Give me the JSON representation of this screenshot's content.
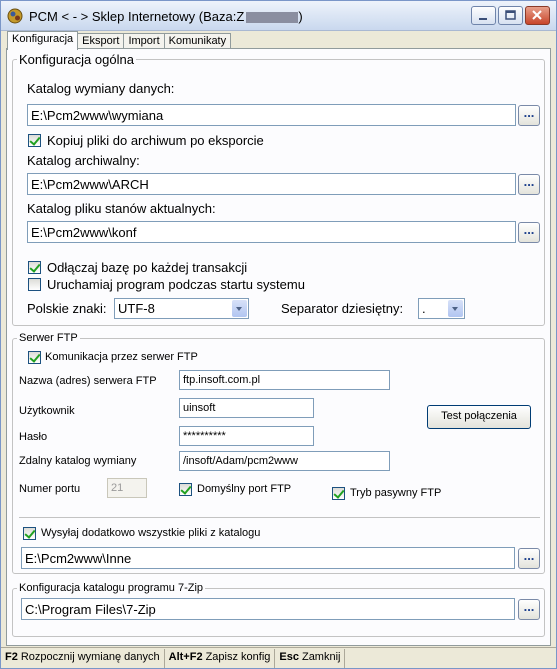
{
  "window": {
    "title_prefix": "PCM  < - > Sklep Internetowy (Baza:Z",
    "title_suffix": ")"
  },
  "tabs": [
    {
      "label": "Konfiguracja"
    },
    {
      "label": "Eksport"
    },
    {
      "label": "Import"
    },
    {
      "label": "Komunikaty"
    }
  ],
  "general": {
    "legend": "Konfiguracja ogólna",
    "exchange_dir_label": "Katalog wymiany danych:",
    "exchange_dir_value": "E:\\Pcm2www\\wymiana",
    "copy_archive_label": "Kopiuj pliki do archiwum po eksporcie",
    "copy_archive_checked": true,
    "archive_dir_label": "Katalog archiwalny:",
    "archive_dir_value": "E:\\Pcm2www\\ARCH",
    "state_dir_label": "Katalog pliku stanów aktualnych:",
    "state_dir_value": "E:\\Pcm2www\\konf",
    "disconnect_label": "Odłączaj bazę po każdej transakcji",
    "disconnect_checked": true,
    "autostart_label": "Uruchamiaj program podczas startu systemu",
    "autostart_checked": false,
    "polish_chars_label": "Polskie znaki:",
    "polish_chars_value": "UTF-8",
    "decimal_sep_label": "Separator dziesiętny:",
    "decimal_sep_value": ".",
    "browse_label": "..."
  },
  "ftp": {
    "legend": "Serwer FTP",
    "use_ftp_label": "Komunikacja przez serwer FTP",
    "use_ftp_checked": true,
    "server_label": "Nazwa (adres) serwera FTP",
    "server_value": "ftp.insoft.com.pl",
    "user_label": "Użytkownik",
    "user_value": "uinsoft",
    "password_label": "Hasło",
    "password_value": "**********",
    "remote_dir_label": "Zdalny katalog wymiany",
    "remote_dir_value": "/insoft/Adam/pcm2www",
    "port_label": "Numer portu",
    "port_value": "21",
    "default_port_label": "Domyślny port FTP",
    "default_port_checked": true,
    "passive_label": "Tryb pasywny FTP",
    "passive_checked": true,
    "test_button": "Test połączenia",
    "send_all_label": "Wysyłaj dodatkowo wszystkie pliki z katalogu",
    "send_all_checked": true,
    "send_all_dir_value": "E:\\Pcm2www\\Inne"
  },
  "zip": {
    "legend": "Konfiguracja katalogu programu 7-Zip",
    "dir_value": "C:\\Program Files\\7-Zip"
  },
  "statusbar": [
    {
      "key": "F2",
      "text": "Rozpocznij wymianę danych"
    },
    {
      "key": "Alt+F2",
      "text": "Zapisz konfig"
    },
    {
      "key": "Esc",
      "text": "Zamknij"
    }
  ]
}
